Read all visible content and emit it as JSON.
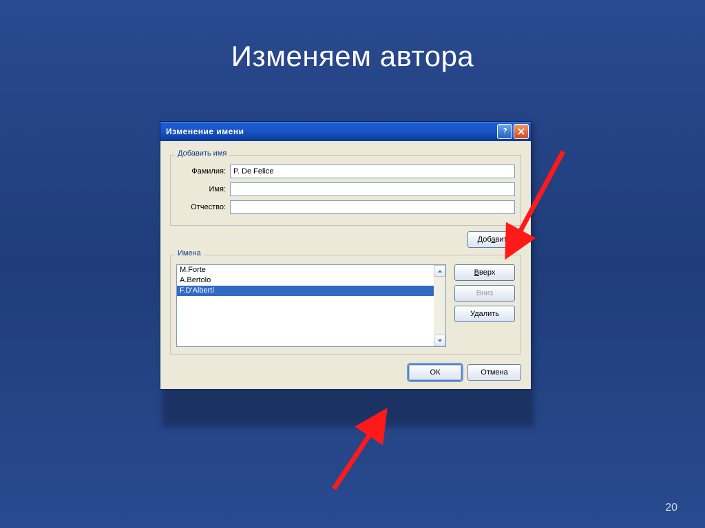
{
  "slide": {
    "title": "Изменяем автора",
    "number": "20"
  },
  "dialog": {
    "title": "Изменение имени",
    "group_add": {
      "legend": "Добавить имя",
      "surname_label": "Фамилия:",
      "surname_value": "P. De Felice",
      "firstname_label": "Имя:",
      "firstname_value": "",
      "patronymic_label": "Отчество:",
      "patronymic_value": ""
    },
    "add_button": "Добавить",
    "group_names": {
      "legend": "Имена",
      "items": [
        "M.Forte",
        "A.Bertolo",
        "F.D'Alberti"
      ],
      "selected_index": 2
    },
    "side": {
      "up": "Вверх",
      "down": "Вниз",
      "delete": "Удалить"
    },
    "ok": "ОК",
    "cancel": "Отмена"
  }
}
